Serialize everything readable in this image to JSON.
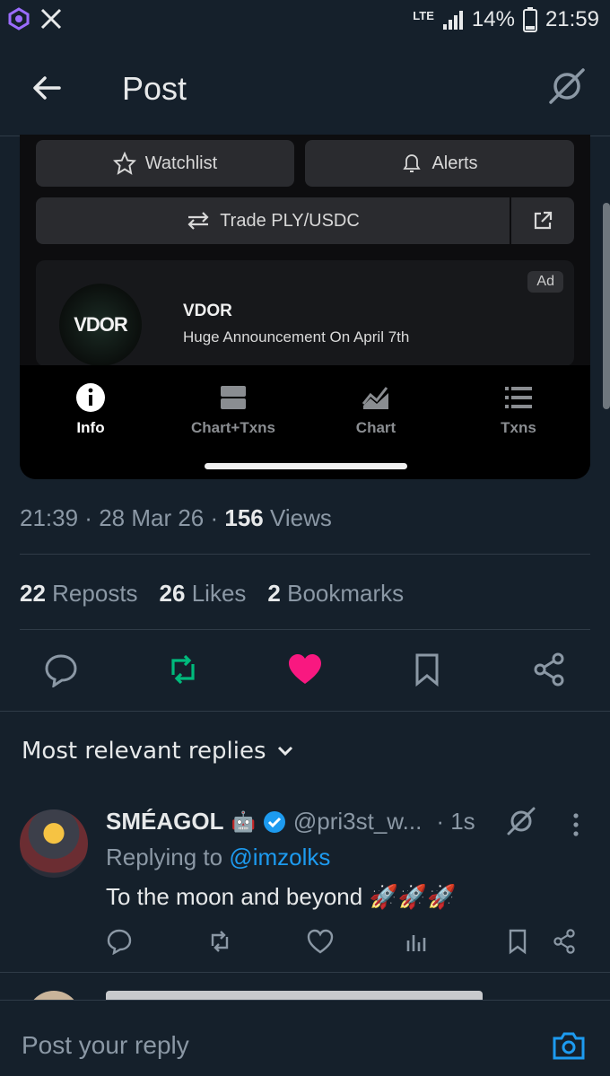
{
  "status_bar": {
    "network": "LTE",
    "battery": "14%",
    "time": "21:59"
  },
  "header": {
    "title": "Post"
  },
  "embed": {
    "watchlist_label": "Watchlist",
    "alerts_label": "Alerts",
    "trade_label": "Trade PLY/USDC",
    "ad": {
      "badge": "Ad",
      "logo_text": "VDOR",
      "name": "VDOR",
      "text": "Huge Announcement On April 7th"
    },
    "tabs": [
      {
        "label": "Info",
        "icon": "info-icon"
      },
      {
        "label": "Chart+Txns",
        "icon": "split-icon"
      },
      {
        "label": "Chart",
        "icon": "chart-icon"
      },
      {
        "label": "Txns",
        "icon": "list-icon"
      }
    ]
  },
  "post_meta": {
    "time": "21:39",
    "date": "28 Mar 26",
    "views_count": "156",
    "views_label": "Views"
  },
  "stats": {
    "reposts_count": "22",
    "reposts_label": "Reposts",
    "likes_count": "26",
    "likes_label": "Likes",
    "bookmarks_count": "2",
    "bookmarks_label": "Bookmarks"
  },
  "colors": {
    "repost": "#00ba7c",
    "like": "#f91880",
    "link": "#1d9bf0",
    "background": "#15202b"
  },
  "replies_header": {
    "label": "Most relevant replies"
  },
  "reply": {
    "name": "SMÉAGOL",
    "badge_emoji": "🤖",
    "handle": "@pri3st_w...",
    "time": "· 1s",
    "replying_prefix": "Replying to",
    "replying_to": "@imzolks",
    "text": "To the moon and beyond 🚀🚀🚀"
  },
  "composer": {
    "placeholder": "Post your reply"
  }
}
